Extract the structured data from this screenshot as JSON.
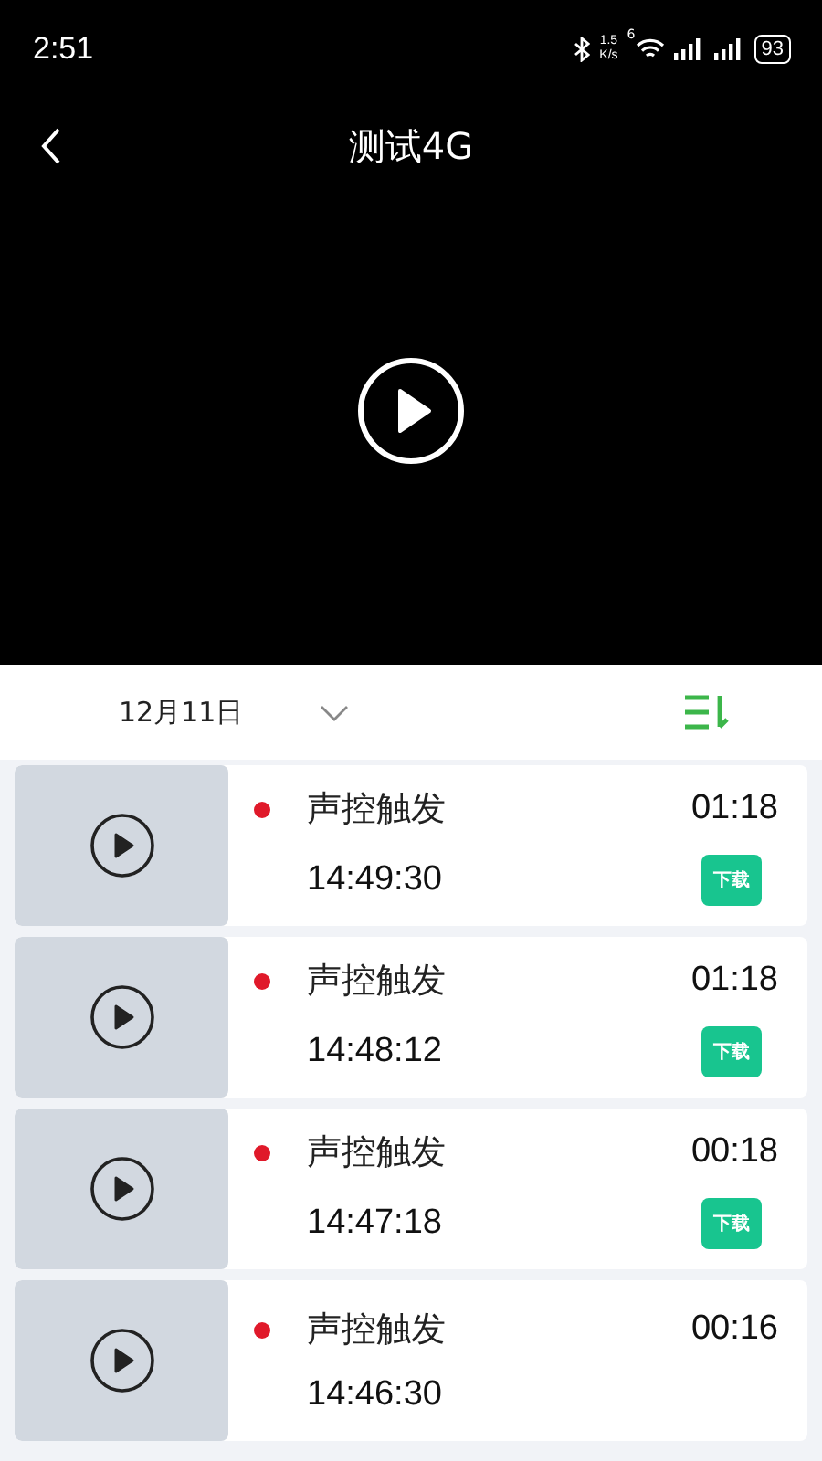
{
  "status_bar": {
    "time": "2:51",
    "speed_value": "1.5",
    "speed_unit": "K/s",
    "wifi_label": "6",
    "battery": "93"
  },
  "header": {
    "title": "测试4G"
  },
  "date_bar": {
    "date": "12月11日"
  },
  "recordings": [
    {
      "trigger": "声控触发",
      "time": "14:49:30",
      "duration": "01:18",
      "color": "#e0192a",
      "download": "下载"
    },
    {
      "trigger": "声控触发",
      "time": "14:48:12",
      "duration": "01:18",
      "color": "#e0192a",
      "download": "下载"
    },
    {
      "trigger": "声控触发",
      "time": "14:47:18",
      "duration": "00:18",
      "color": "#e0192a",
      "download": "下载"
    },
    {
      "trigger": "声控触发",
      "time": "14:46:30",
      "duration": "00:16",
      "color": "#e0192a"
    }
  ]
}
